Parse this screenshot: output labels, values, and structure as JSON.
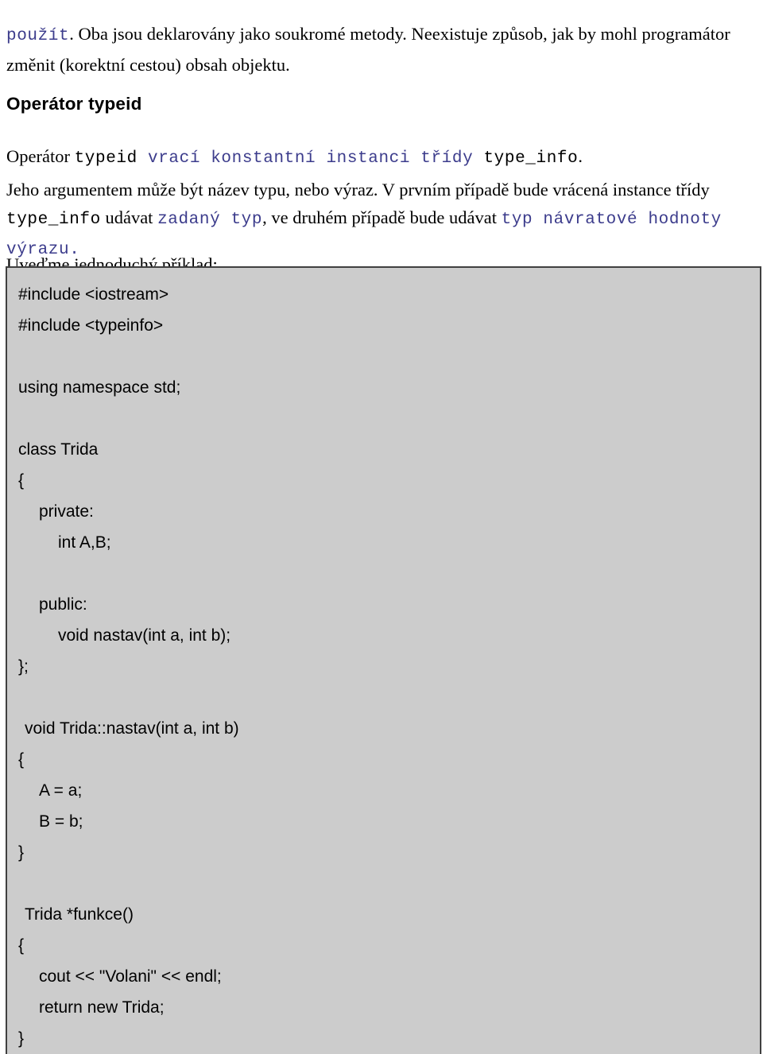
{
  "document": {
    "language": "cs",
    "paragraph_intro": {
      "code_lead": "použít",
      "text": ". Oba jsou deklarovány jako soukromé metody. Neexistuje způsob, jak by mohl programátor změnit (korektní cestou) obsah objektu."
    },
    "heading": "Operátor typeid",
    "paragraph_typeid": {
      "part1_serif": "Operátor ",
      "part2_mono_black": "typeid ",
      "part3_mono_blue": "vrací konstantní instanci třídy ",
      "part4_mono_black": "type_info",
      "part5_serif": "."
    },
    "paragraph_argument": {
      "part1_serif": "Jeho argumentem může být název typu, nebo výraz. V prvním případě bude vrácená instance třídy ",
      "part2_mono_black": "type_info",
      "part3_serif": " udávat ",
      "part4_mono_blue": "zadaný typ",
      "part5_serif": ", ve druhém případě bude udávat ",
      "part6_mono_blue": "typ návratové hodnoty výrazu."
    },
    "paragraph_example": "Uveďme jednoduchý příklad:"
  },
  "code_block": {
    "background_color": "#cccccc",
    "border_color": "#404040",
    "text_color": "#000000",
    "lines": [
      {
        "text": "#include <iostream>",
        "indent": 0
      },
      {
        "text": "#include <typeinfo>",
        "indent": 0
      },
      {
        "text": "",
        "indent": 0
      },
      {
        "text": "using namespace std;",
        "indent": 0
      },
      {
        "text": "",
        "indent": 0
      },
      {
        "text": "class Trida",
        "indent": 0
      },
      {
        "text": "{",
        "indent": 0
      },
      {
        "text": "private:",
        "indent": 1
      },
      {
        "text": "int A,B;",
        "indent": 2
      },
      {
        "text": "",
        "indent": 0
      },
      {
        "text": "public:",
        "indent": 1
      },
      {
        "text": "void nastav(int a, int b);",
        "indent": 2
      },
      {
        "text": "};",
        "indent": 0
      },
      {
        "text": "",
        "indent": 0
      },
      {
        "text": "void Trida::nastav(int a, int b)",
        "indent": 0.5
      },
      {
        "text": "{",
        "indent": 0
      },
      {
        "text": "A = a;",
        "indent": 1
      },
      {
        "text": "B = b;",
        "indent": 1
      },
      {
        "text": "}",
        "indent": 0
      },
      {
        "text": "",
        "indent": 0
      },
      {
        "text": "Trida *funkce()",
        "indent": 0.5
      },
      {
        "text": "{",
        "indent": 0
      },
      {
        "text": "cout << \"Volani\" << endl;",
        "indent": 1
      },
      {
        "text": "return new Trida;",
        "indent": 1
      },
      {
        "text": "}",
        "indent": 0
      }
    ]
  },
  "colors": {
    "code_keyword_blue": "#3c3c8c",
    "body_text": "#000000",
    "page_background": "#ffffff"
  }
}
